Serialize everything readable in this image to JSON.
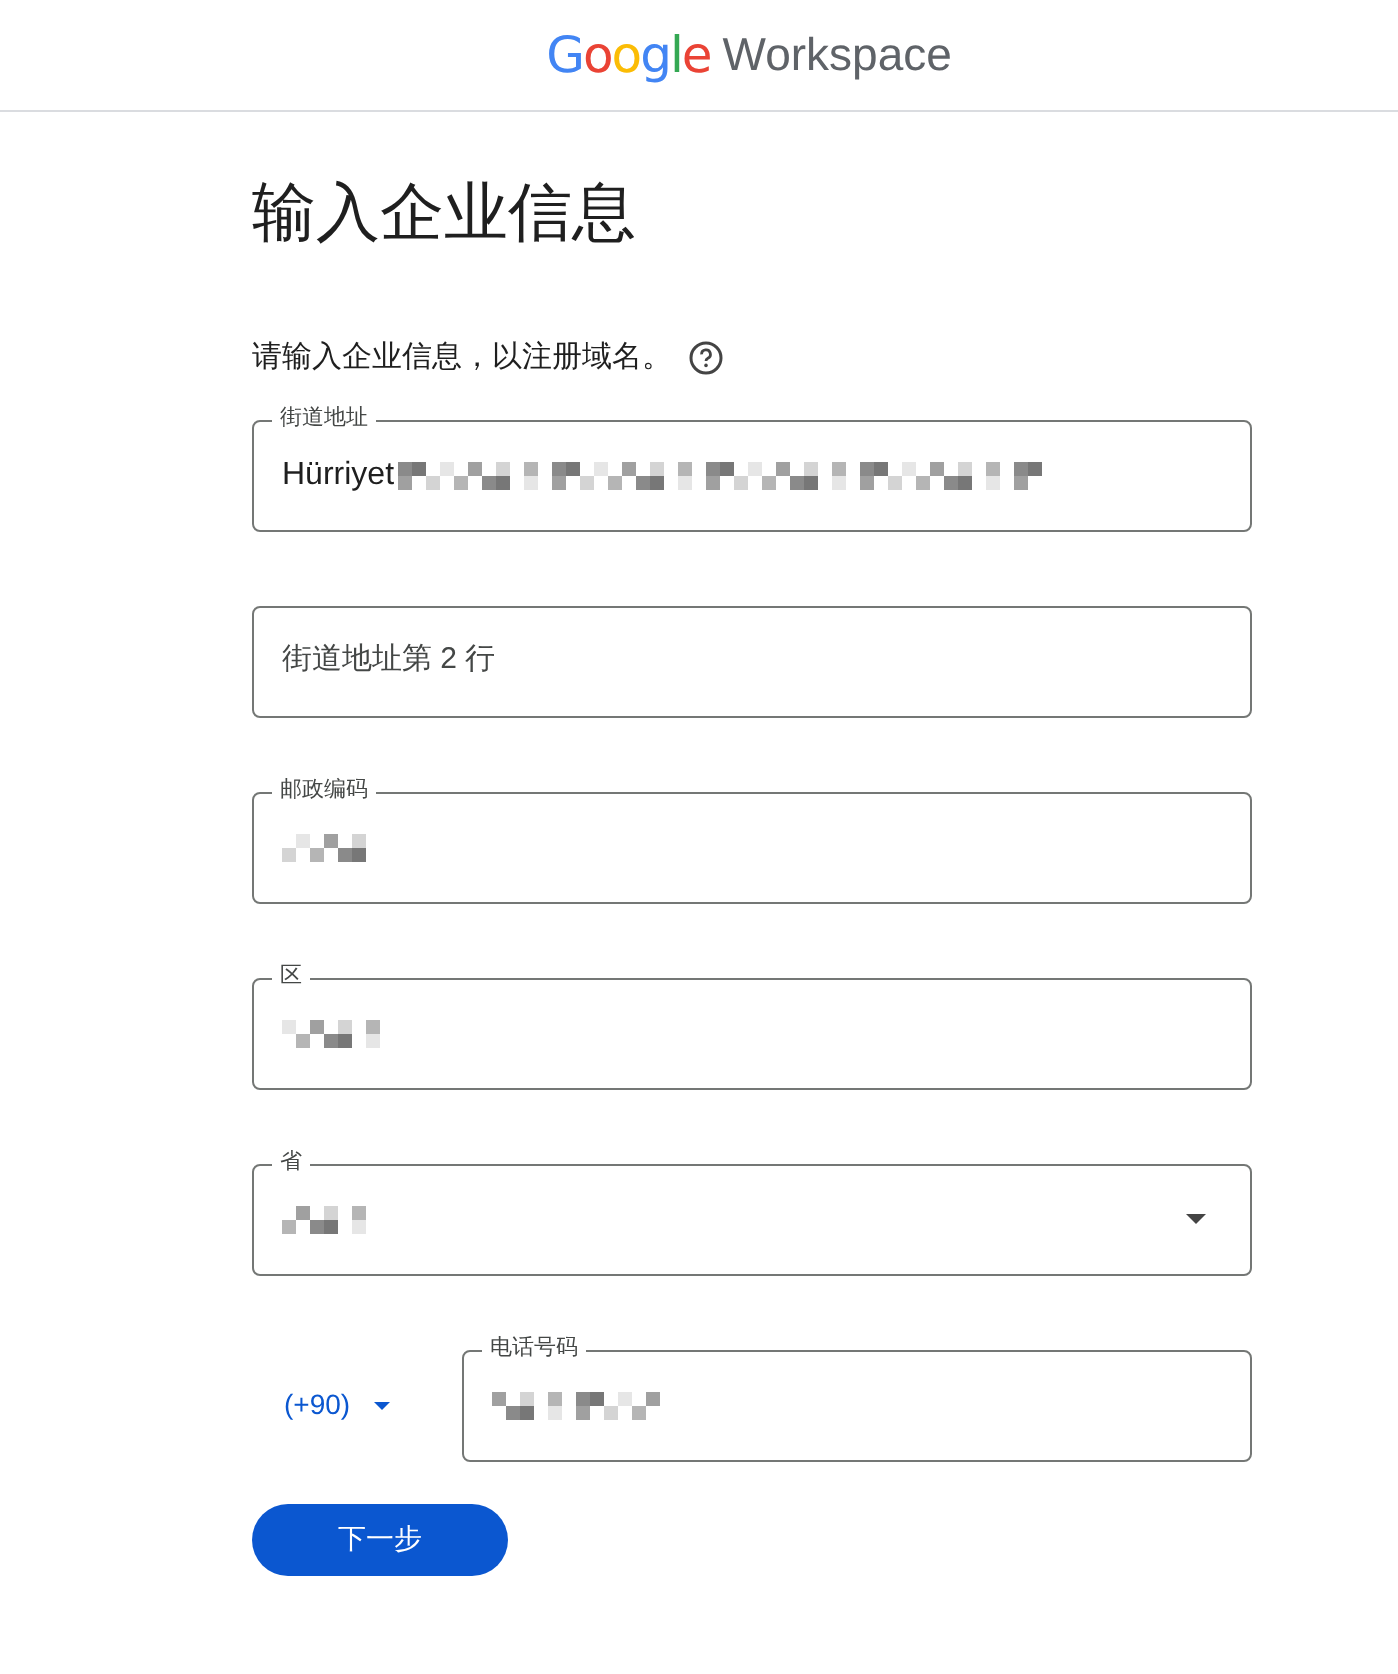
{
  "header": {
    "logo_brand": "Google",
    "logo_product": "Workspace"
  },
  "title": "输入企业信息",
  "intro": "请输入企业信息，以注册域名。",
  "fields": [
    {
      "kind": "text",
      "label": "街道地址",
      "value": "Hürriyet",
      "redacted": true
    },
    {
      "kind": "text",
      "placeholder": "街道地址第 2 行",
      "redacted": false
    },
    {
      "kind": "text",
      "label": "邮政编码",
      "redacted": true
    },
    {
      "kind": "text",
      "label": "区",
      "redacted": true
    },
    {
      "kind": "select",
      "label": "省",
      "redacted": true
    },
    {
      "kind": "phone",
      "country_code": "(+90)",
      "label": "电话号码",
      "redacted": true
    }
  ],
  "next_button": "下一步"
}
